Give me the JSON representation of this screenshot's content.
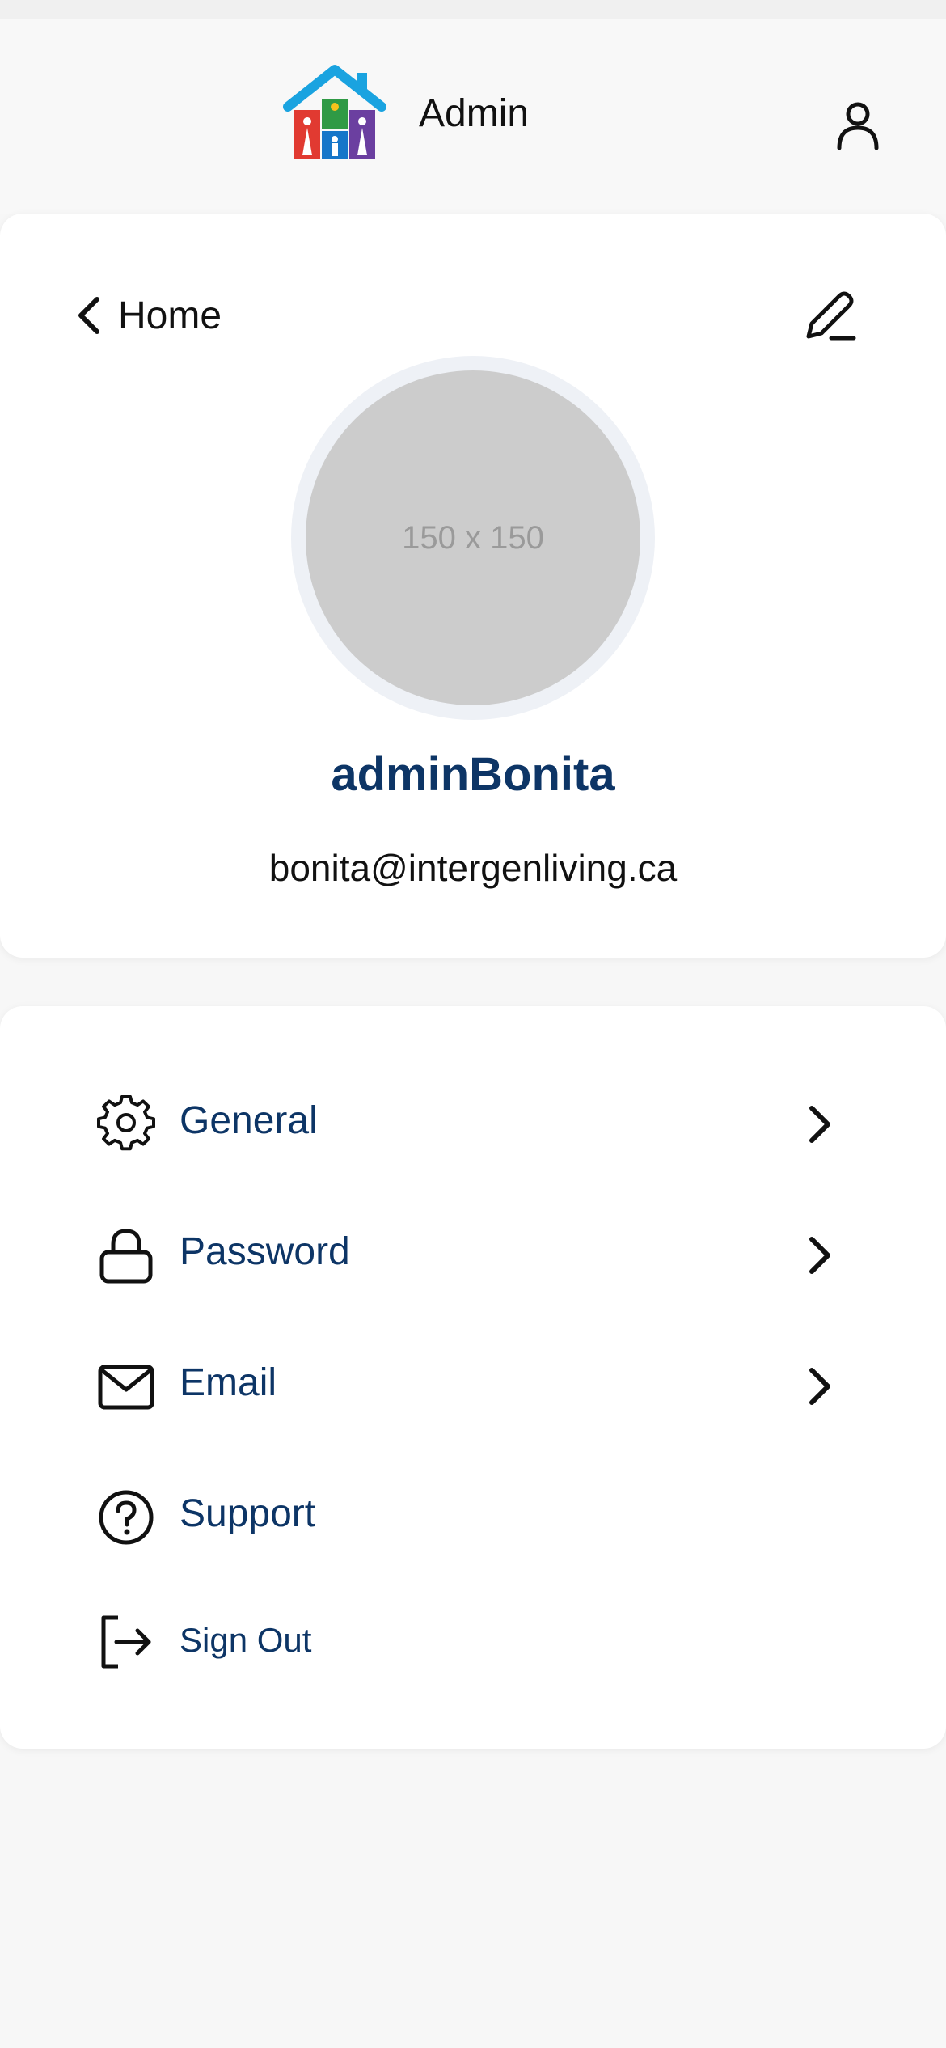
{
  "header": {
    "title": "Admin",
    "logo_icon": "house-family-logo-icon",
    "account_icon": "user-icon"
  },
  "profile": {
    "back_label": "Home",
    "avatar_placeholder": "150 x 150",
    "name": "adminBonita",
    "email": "bonita@intergenliving.ca",
    "edit_icon": "pencil-icon"
  },
  "menu": {
    "items": [
      {
        "label": "General",
        "icon": "gear-icon"
      },
      {
        "label": "Password",
        "icon": "lock-icon"
      },
      {
        "label": "Email",
        "icon": "mail-icon"
      },
      {
        "label": "Support",
        "icon": "help-circle-icon"
      },
      {
        "label": "Sign Out",
        "icon": "sign-out-icon"
      }
    ]
  },
  "colors": {
    "accent": "#0d3566",
    "background": "#f7f7f7",
    "card": "#ffffff",
    "avatar_placeholder": "#cccccc"
  }
}
